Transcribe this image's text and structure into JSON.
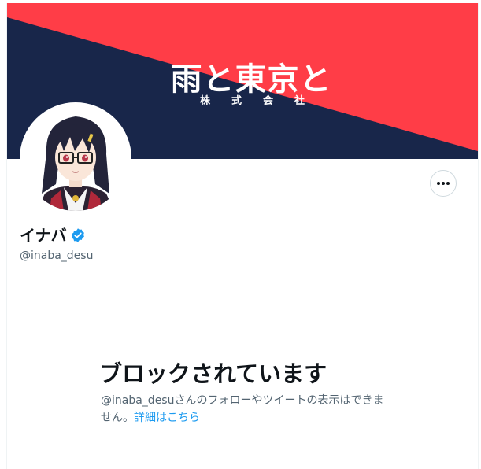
{
  "banner": {
    "title": "雨と東京と",
    "subtitle": "株式会社",
    "colors": {
      "red": "#ff3d47",
      "navy": "#18264a"
    }
  },
  "profile": {
    "name": "イナバ",
    "handle": "@inaba_desu",
    "verified": true,
    "avatar_icon": "avatar-anime-character-icon"
  },
  "actions": {
    "more_icon": "more-horizontal-icon"
  },
  "blocked": {
    "title": "ブロックされています",
    "message": "@inaba_desuさんのフォローやツイートの表示はできません。",
    "details_link": "詳細はこちら"
  },
  "colors": {
    "text_primary": "#0f1419",
    "text_secondary": "#536471",
    "link": "#1d9bf0",
    "verified": "#1d9bf0"
  }
}
